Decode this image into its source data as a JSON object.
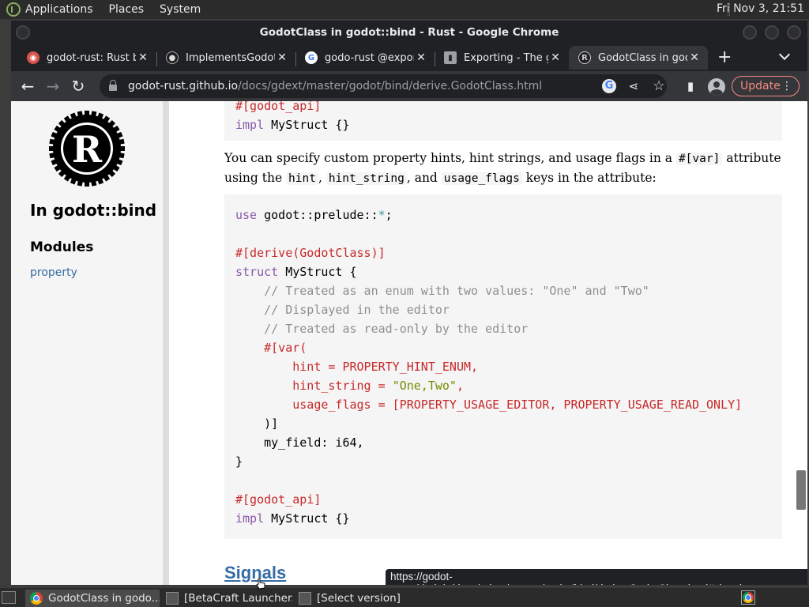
{
  "system_panel": {
    "menus": [
      "Applications",
      "Places",
      "System"
    ],
    "clock": "Fri Nov  3, 21:51"
  },
  "window": {
    "title": "GodotClass in godot::bind - Rust - Google Chrome"
  },
  "tabs": [
    {
      "title": "godot-rust: Rust bi",
      "favicon": "owl-icon"
    },
    {
      "title": "ImplementsGodotE",
      "favicon": "github-icon"
    },
    {
      "title": "godo-rust @export",
      "favicon": "google-icon"
    },
    {
      "title": "Exporting - The gd",
      "favicon": "book-icon"
    },
    {
      "title": "GodotClass in godo",
      "favicon": "rust-icon",
      "active": true
    }
  ],
  "toolbar": {
    "url_host": "godot-rust.github.io",
    "url_path": "/docs/gdext/master/godot/bind/derive.GodotClass.html",
    "update_label": "Update"
  },
  "sidebar": {
    "crate_title": "In godot::bind",
    "modules_title": "Modules",
    "module_link": "property"
  },
  "content": {
    "top_code": [
      "#[godot_api]",
      "impl MyStruct {}"
    ],
    "para_text_1": "You can specify custom property hints, hint strings, and usage flags in a ",
    "para_code_1": "#[var]",
    "para_text_2": " attribute using the ",
    "para_code_2": "hint",
    "para_text_3": ", ",
    "para_code_3": "hint_string",
    "para_text_4": ", and ",
    "para_code_4": "usage_flags",
    "para_text_5": " keys in the attribute:",
    "code": {
      "l1_kw": "use",
      "l1_rest": " godot::prelude::",
      "l1_star": "*",
      "l1_end": ";",
      "l3": "#[derive(GodotClass)]",
      "l4_kw": "struct",
      "l4_rest": " MyStruct {",
      "l5": "    // Treated as an enum with two values: \"One\" and \"Two\"",
      "l6": "    // Displayed in the editor",
      "l7": "    // Treated as read-only by the editor",
      "l8": "    #[var(",
      "l9": "        hint = PROPERTY_HINT_ENUM,",
      "l10_a": "        hint_string = ",
      "l10_str": "\"One,Two\"",
      "l10_b": ",",
      "l11": "        usage_flags = [PROPERTY_USAGE_EDITOR, PROPERTY_USAGE_READ_ONLY]",
      "l12": "    )]",
      "l13": "    my_field: i64,",
      "l14": "}",
      "l16": "#[godot_api]",
      "l17_kw": "impl",
      "l17_rest": " MyStruct {}"
    },
    "signals_heading": "Signals"
  },
  "status_bubble": "https://godot-rust.github.io/docs/gdext/master/godot/bind/derive.GodotClass.html#signals",
  "taskbar": {
    "items": [
      "GodotClass in godo...",
      "[BetaCraft Launcher...",
      "[Select version]"
    ]
  }
}
